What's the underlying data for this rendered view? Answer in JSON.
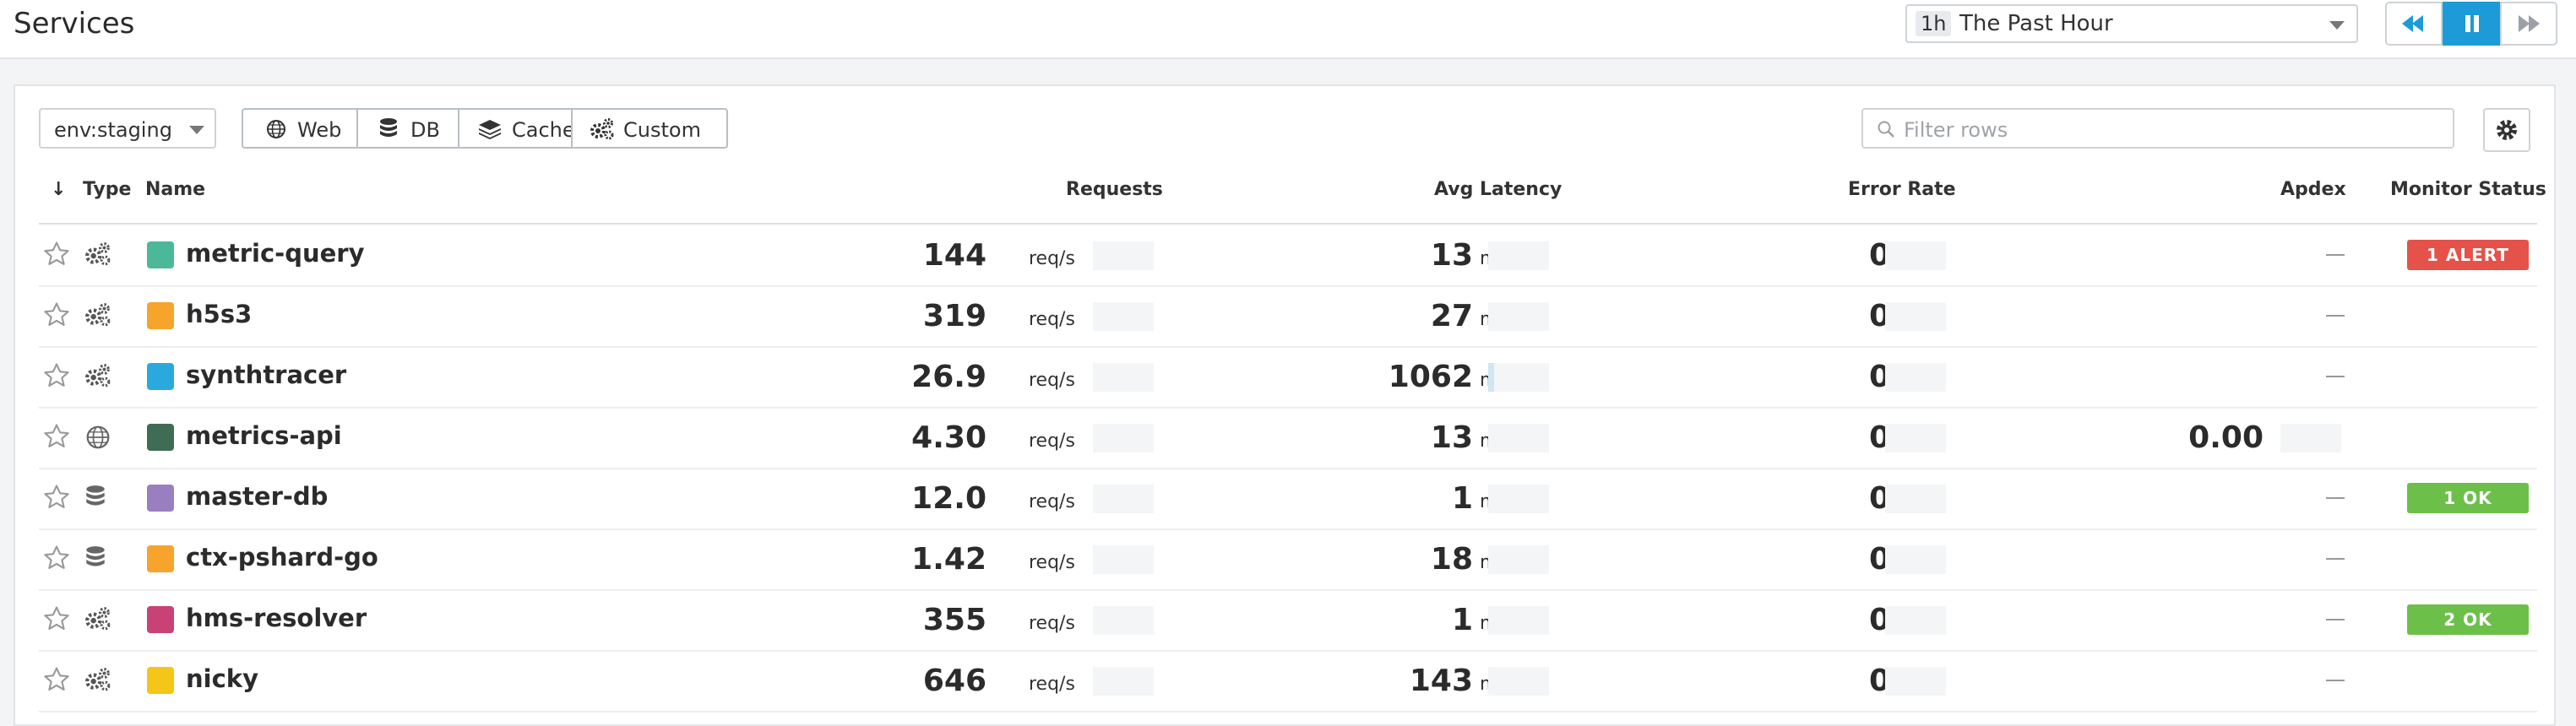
{
  "page": {
    "title": "Services"
  },
  "timeframe": {
    "shortcut": "1h",
    "label": "The Past Hour"
  },
  "playback": {
    "rewind_icon": "rewind-icon",
    "pause_icon": "pause-icon",
    "forward_icon": "fast-forward-icon",
    "active_color": "#1d9bd8"
  },
  "filters": {
    "env": "env:staging",
    "type_buttons": [
      {
        "label": "Web",
        "icon": "globe-icon"
      },
      {
        "label": "DB",
        "icon": "database-icon"
      },
      {
        "label": "Cache",
        "icon": "layers-icon"
      },
      {
        "label": "Custom",
        "icon": "gears-icon"
      }
    ],
    "search_placeholder": "Filter rows"
  },
  "table": {
    "sort_indicator": "↓",
    "columns": {
      "type": "Type",
      "name": "Name",
      "requests": "Requests",
      "latency": "Avg Latency",
      "error_rate": "Error Rate",
      "apdex": "Apdex",
      "monitor": "Monitor Status"
    },
    "units": {
      "requests": "req/s",
      "latency": "ms",
      "error_rate": "%"
    },
    "rows": [
      {
        "type_icon": "gears-icon",
        "color": "#4cb89a",
        "name": "metric-query",
        "requests": "144",
        "latency": "13",
        "latency_share": 0,
        "error_rate": "0",
        "apdex": "",
        "monitor": "1 ALERT",
        "monitor_color": "#e5524a"
      },
      {
        "type_icon": "gears-icon",
        "color": "#f7a42c",
        "name": "h5s3",
        "requests": "319",
        "latency": "27",
        "latency_share": 0,
        "error_rate": "0",
        "apdex": "",
        "monitor": "",
        "monitor_color": ""
      },
      {
        "type_icon": "gears-icon",
        "color": "#2aa9dd",
        "name": "synthtracer",
        "requests": "26.9",
        "latency": "1062",
        "latency_share": 0.1,
        "error_rate": "0",
        "apdex": "",
        "monitor": "",
        "monitor_color": ""
      },
      {
        "type_icon": "globe-icon",
        "color": "#3e6c55",
        "name": "metrics-api",
        "requests": "4.30",
        "latency": "13",
        "latency_share": 0,
        "error_rate": "0",
        "apdex": "0.00",
        "monitor": "",
        "monitor_color": ""
      },
      {
        "type_icon": "database-icon",
        "color": "#9a7fc0",
        "name": "master-db",
        "requests": "12.0",
        "latency": "1",
        "latency_share": 0,
        "error_rate": "0",
        "apdex": "",
        "monitor": "1 OK",
        "monitor_color": "#6cc04a"
      },
      {
        "type_icon": "database-icon",
        "color": "#f7a42c",
        "name": "ctx-pshard-go",
        "requests": "1.42",
        "latency": "18",
        "latency_share": 0,
        "error_rate": "0",
        "apdex": "",
        "monitor": "",
        "monitor_color": ""
      },
      {
        "type_icon": "gears-icon",
        "color": "#c94277",
        "name": "hms-resolver",
        "requests": "355",
        "latency": "1",
        "latency_share": 0,
        "error_rate": "0",
        "apdex": "",
        "monitor": "2 OK",
        "monitor_color": "#6cc04a"
      },
      {
        "type_icon": "gears-icon",
        "color": "#f5c518",
        "name": "nicky",
        "requests": "646",
        "latency": "143",
        "latency_share": 0,
        "error_rate": "0",
        "apdex": "",
        "monitor": "",
        "monitor_color": ""
      }
    ]
  }
}
